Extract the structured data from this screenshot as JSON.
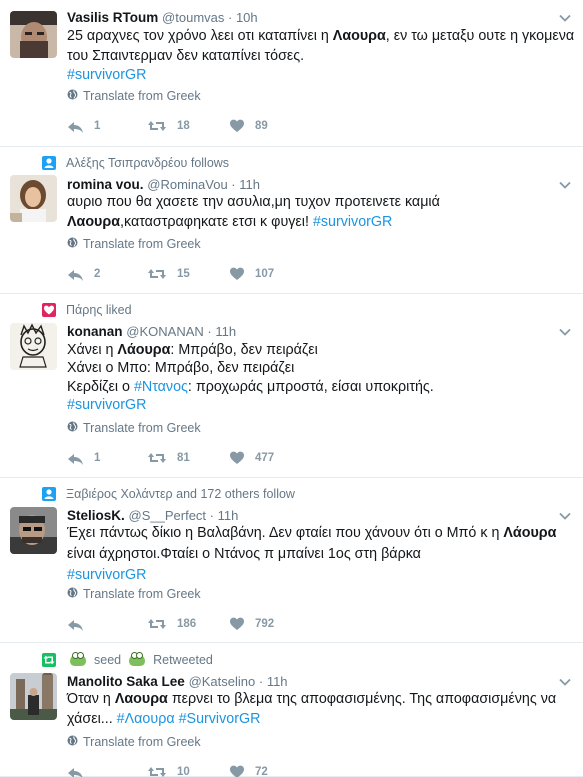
{
  "tweets": [
    {
      "context": null,
      "name": "Vasilis RToum",
      "handle": "@toumvas",
      "time": "10h",
      "lines": [
        [
          {
            "t": "25 αραχνες τον χρόνο λεει οτι καταπίνει η "
          },
          {
            "t": "Λαουρα",
            "b": true
          },
          {
            "t": ", εν τω μεταξυ ουτε η γκομενα"
          }
        ],
        [
          {
            "t": "του Σπαιντερμαν δεν καταπίνει τόσες."
          }
        ],
        [
          {
            "t": "#survivorGR",
            "h": true
          }
        ]
      ],
      "translate": "Translate from Greek",
      "replies": "1",
      "retweets": "18",
      "likes": "89"
    },
    {
      "context": {
        "type": "follow",
        "text": "Αλέξης Τσιπρανδρέου follows"
      },
      "name": "romina vou.",
      "handle": "@RominaVou",
      "time": "11h",
      "lines": [
        [
          {
            "t": "αυριο που θα χασετε την ασυλια,μη τυχον προτεινετε καμιά"
          }
        ],
        [
          {
            "t": "Λαουρα",
            "b": true
          },
          {
            "t": ",καταστραφηκατε ετσι κ φυγει! "
          },
          {
            "t": "#survivorGR",
            "h": true
          }
        ]
      ],
      "translate": "Translate from Greek",
      "replies": "2",
      "retweets": "15",
      "likes": "107"
    },
    {
      "context": {
        "type": "like",
        "text": "Πάρης liked"
      },
      "name": "konanan",
      "handle": "@KONANAN",
      "time": "11h",
      "lines": [
        [
          {
            "t": "Χάνει η "
          },
          {
            "t": "Λάουρα",
            "b": true
          },
          {
            "t": ": Μπράβο, δεν πειράζει"
          }
        ],
        [
          {
            "t": "Χάνει ο Μπο: Μπράβο, δεν πειράζει"
          }
        ],
        [
          {
            "t": "Κερδίζει ο "
          },
          {
            "t": "#Ντανος",
            "h": true
          },
          {
            "t": ": προχωράς μπροστά, είσαι υποκριτής."
          }
        ],
        [
          {
            "t": "#survivorGR",
            "h": true
          }
        ]
      ],
      "translate": "Translate from Greek",
      "replies": "1",
      "retweets": "81",
      "likes": "477"
    },
    {
      "context": {
        "type": "follow",
        "text": "Ξαβιέρος Χολάντερ and 172 others follow"
      },
      "name": "SteliosK.",
      "handle": "@S__Perfect",
      "time": "11h",
      "lines": [
        [
          {
            "t": "Έχει πάντως δίκιο η Βαλαβάνη. Δεν φταίει που χάνουν ότι ο Μπό κ η "
          },
          {
            "t": "Λάουρα",
            "b": true
          }
        ],
        [
          {
            "t": "είναι άχρηστοι.Φταίει ο Ντάνος π μπαίνει 1ος στη βάρκα"
          }
        ],
        [
          {
            "t": "#survivorGR",
            "h": true
          }
        ]
      ],
      "translate": "Translate from Greek",
      "replies": "",
      "retweets": "186",
      "likes": "792"
    },
    {
      "context": {
        "type": "retweet",
        "user": "seed",
        "text": "Retweeted"
      },
      "name": "Manolito Saka Lee",
      "handle": "@Katselino",
      "time": "11h",
      "lines": [
        [
          {
            "t": "Όταν η "
          },
          {
            "t": "Λαουρα",
            "b": true
          },
          {
            "t": " περνει το βλεμα της αποφασισμένης. Της αποφασισμένης να"
          }
        ],
        [
          {
            "t": "χάσει... "
          },
          {
            "t": "#Λαουρα",
            "h": true
          },
          {
            "t": " "
          },
          {
            "t": "#SurvivorGR",
            "h": true
          }
        ]
      ],
      "translate": "Translate from Greek",
      "replies": "",
      "retweets": "10",
      "likes": "72"
    }
  ],
  "colors": {
    "link": "#1b95e0",
    "muted": "#657786",
    "follow_icon": "#1da1f2",
    "like_icon": "#e0245e",
    "retweet_icon": "#17bf63"
  },
  "icons": {
    "reply": "reply-icon",
    "retweet": "retweet-icon",
    "like": "heart-icon",
    "globe": "globe-icon",
    "caret": "chevron-down-icon"
  }
}
